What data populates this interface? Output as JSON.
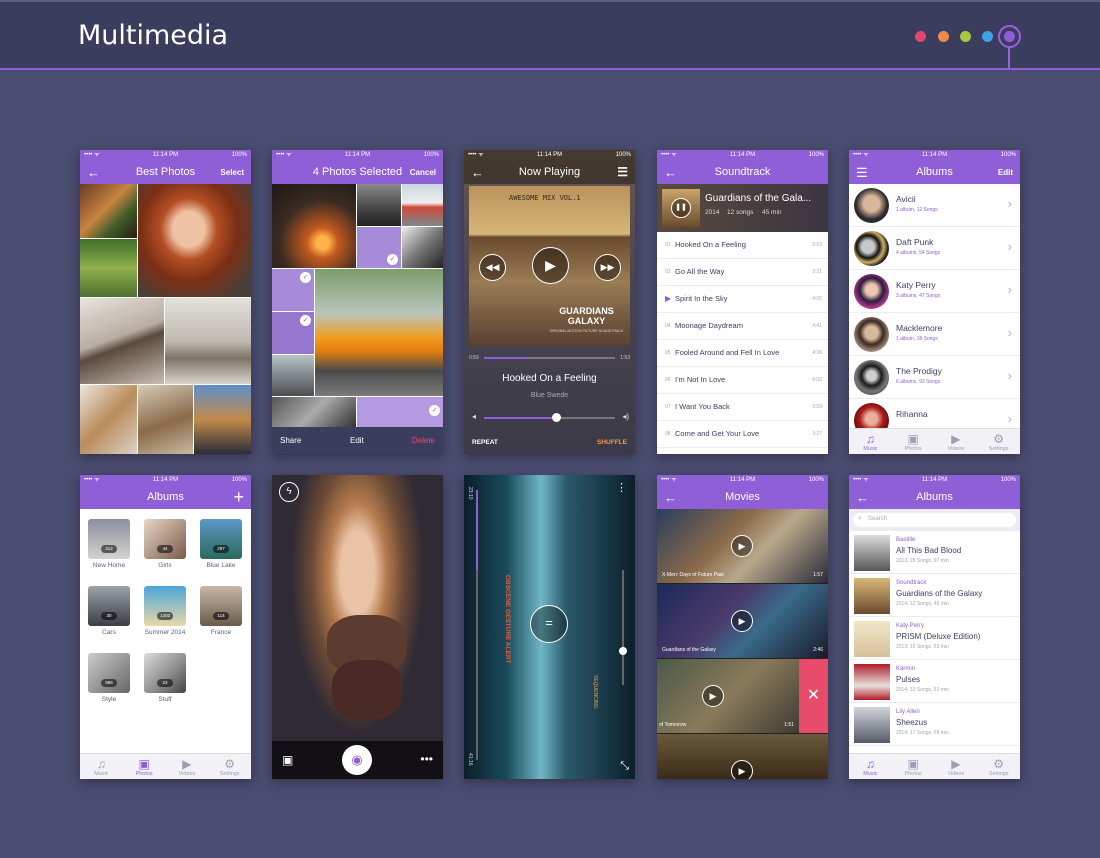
{
  "header": {
    "title": "Multimedia",
    "dot_colors": [
      "#e0476f",
      "#f2894b",
      "#a7c940",
      "#3fa2e8",
      "#8e5fd6"
    ]
  },
  "status": {
    "carrier": "•••• ᯤ",
    "time": "11:14 PM",
    "battery": "100%"
  },
  "tabs": {
    "music": "Music",
    "photos": "Photos",
    "videos": "Videos",
    "settings": "Settings"
  },
  "best_photos": {
    "title": "Best Photos",
    "action": "Select"
  },
  "photos_selected": {
    "title": "4 Photos Selected",
    "action": "Cancel",
    "share": "Share",
    "edit": "Edit",
    "delete": "Delete"
  },
  "now_playing": {
    "title": "Now Playing",
    "time_elapsed": "0:59",
    "time_total": "1:53",
    "progress": 0.33,
    "song": "Hooked On a Feeling",
    "artist": "Blue Swede",
    "volume": 0.55,
    "repeat": "REPEAT",
    "shuffle": "SHUFFLE",
    "cover_top": "AWESOME MIX VOL.1",
    "cover_title": "GUARDIANS GALAXY",
    "cover_sub": "ORIGINAL MOTION PICTURE SOUNDTRACK"
  },
  "soundtrack": {
    "title": "Soundtrack",
    "album": "Guardians of the Gala...",
    "year": "2014",
    "songs": "12 songs",
    "duration": "45 min",
    "tracks": [
      {
        "n": "01",
        "name": "Hooked On a Feeling",
        "dur": "2:53"
      },
      {
        "n": "02",
        "name": "Go All the Way",
        "dur": "3:21"
      },
      {
        "n": "▶",
        "name": "Spirit In the Sky",
        "dur": "4:02"
      },
      {
        "n": "04",
        "name": "Moonage Daydream",
        "dur": "4:41"
      },
      {
        "n": "05",
        "name": "Fooled Around and Fell In Love",
        "dur": "4:36"
      },
      {
        "n": "06",
        "name": "I'm Not In Love",
        "dur": "6:03"
      },
      {
        "n": "07",
        "name": "I Want You Back",
        "dur": "2:59"
      },
      {
        "n": "08",
        "name": "Come and Get Your Love",
        "dur": "3:27"
      }
    ]
  },
  "artists": {
    "title": "Albums",
    "action": "Edit",
    "items": [
      {
        "name": "Avicii",
        "meta": "1 album, 12 Songs"
      },
      {
        "name": "Daft Punk",
        "meta": "4 albums, 54 Songs"
      },
      {
        "name": "Katy Perry",
        "meta": "3 albums, 47 Songs"
      },
      {
        "name": "Macklemore",
        "meta": "1 album, 18 Songs"
      },
      {
        "name": "The Prodigy",
        "meta": "6 albums, 93 Songs"
      },
      {
        "name": "Rihanna",
        "meta": ""
      }
    ]
  },
  "photo_albums": {
    "title": "Albums",
    "items": [
      {
        "name": "New Home",
        "count": "312"
      },
      {
        "name": "Girls",
        "count": "44"
      },
      {
        "name": "Blue Lake",
        "count": "287"
      },
      {
        "name": "Cars",
        "count": "30"
      },
      {
        "name": "Summer 2014",
        "count": "1203"
      },
      {
        "name": "France",
        "count": "114"
      },
      {
        "name": "Style",
        "count": "966"
      },
      {
        "name": "Stuff",
        "count": "23"
      }
    ]
  },
  "video": {
    "time_start": "23:10",
    "time_end": "41:16",
    "left_text": "OBSCENE GESTURE  ALERT",
    "right_text": "SEQUENCING"
  },
  "movies": {
    "title": "Movies",
    "items": [
      {
        "name": "X-Men: Days of Future Past",
        "dur": "1:57"
      },
      {
        "name": "Guardians of the Galaxy",
        "dur": "2:46"
      },
      {
        "name": "of Tomorrow",
        "dur": "1:51"
      }
    ]
  },
  "music_albums": {
    "title": "Albums",
    "search": "Search",
    "items": [
      {
        "artist": "Bastille",
        "title": "All This Bad Blood",
        "meta": "2013, 25 Songs, 97 min"
      },
      {
        "artist": "Soundtrack",
        "title": "Guardians of the Galaxy",
        "meta": "2014, 12 Songs, 45 min"
      },
      {
        "artist": "Katy Perry",
        "title": "PRISM (Deluxe Edition)",
        "meta": "2013, 16 Songs, 63 min"
      },
      {
        "artist": "Karmin",
        "title": "Pulses",
        "meta": "2014, 13 Songs, 53 min"
      },
      {
        "artist": "Lily Allen",
        "title": "Sheezus",
        "meta": "2014, 17 Songs, 55 min"
      }
    ]
  }
}
